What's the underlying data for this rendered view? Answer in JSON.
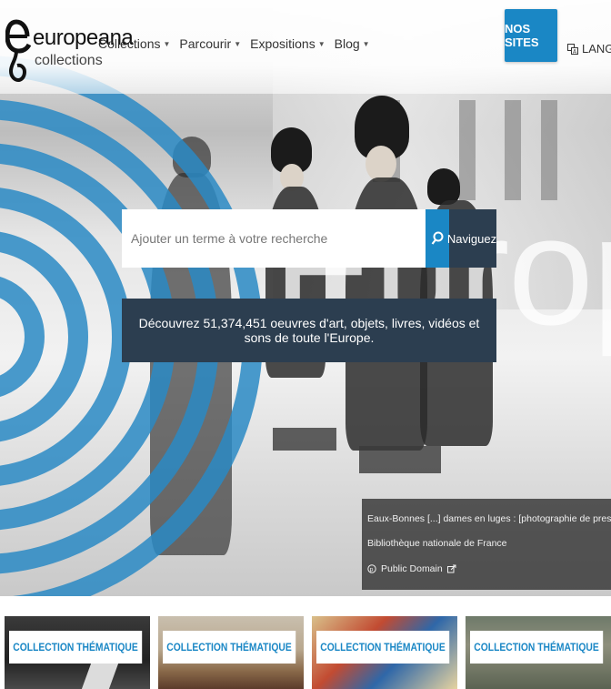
{
  "logo": {
    "name": "europeana",
    "subtitle": "collections"
  },
  "nav": [
    {
      "label": "Collections"
    },
    {
      "label": "Parcourir"
    },
    {
      "label": "Expositions"
    },
    {
      "label": "Blog"
    }
  ],
  "header": {
    "sites_button": "NOS SITES",
    "language_label": "LANGUE"
  },
  "hero": {
    "watermark": "Europeana"
  },
  "search": {
    "placeholder": "Ajouter un terme à votre recherche",
    "browse_label": "Naviguez"
  },
  "tagline": "Découvrez 51,374,451 oeuvres d'art, objets, livres, vidéos et sons de toute l'Europe.",
  "caption": {
    "title": "Eaux-Bonnes [...] dames en luges : [photographie de presse] Agence Rol. Agence photographique",
    "institution": "Bibliothèque nationale de France",
    "license": "Public Domain"
  },
  "cards": [
    {
      "label": "COLLECTION THÉMATIQUE"
    },
    {
      "label": "COLLECTION THÉMATIQUE"
    },
    {
      "label": "COLLECTION THÉMATIQUE"
    },
    {
      "label": "COLLECTION THÉMATIQUE"
    }
  ],
  "colors": {
    "brand_blue": "#1a87c5",
    "navy": "#2c3e50"
  }
}
